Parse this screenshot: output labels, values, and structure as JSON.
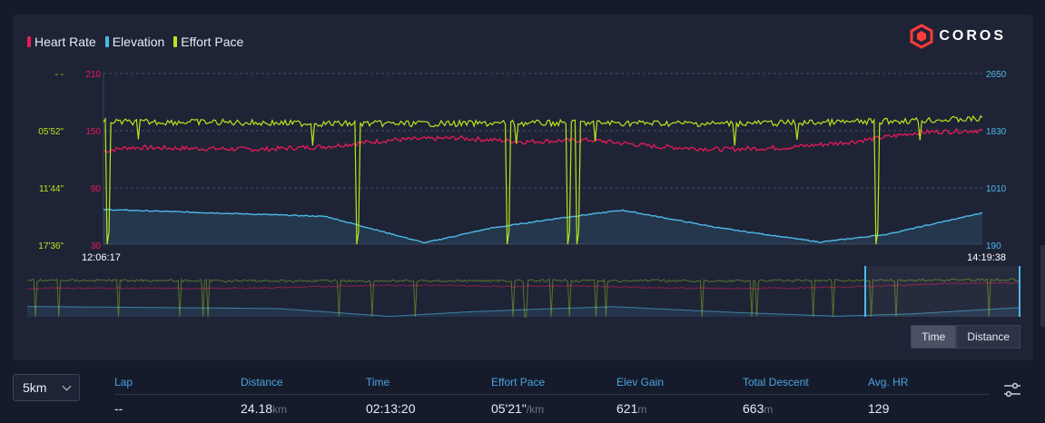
{
  "legend": [
    {
      "label": "Heart Rate",
      "color": "#e8195a"
    },
    {
      "label": "Elevation",
      "color": "#4fb8e8"
    },
    {
      "label": "Effort Pace",
      "color": "#b6e61e"
    }
  ],
  "brand": {
    "name": "COROS",
    "color": "#ff3b3b"
  },
  "axes": {
    "pace_ticks": [
      "- -",
      "05'52\"",
      "11'44\"",
      "17'36\""
    ],
    "hr_ticks": [
      "210",
      "150",
      "90",
      "30"
    ],
    "elev_ticks": [
      "2650",
      "1830",
      "1010",
      "190"
    ],
    "time_start": "12:06:17",
    "time_end": "14:19:38"
  },
  "toggle": {
    "time_label": "Time",
    "distance_label": "Distance",
    "selected": "Time"
  },
  "lap_select": {
    "value": "5km"
  },
  "table": {
    "headers": [
      "Lap",
      "Distance",
      "Time",
      "Effort Pace",
      "Elev Gain",
      "Total Descent",
      "Avg. HR"
    ],
    "row": {
      "lap": "--",
      "distance": "24.18",
      "distance_unit": "km",
      "time": "02:13:20",
      "pace": "05'21\"",
      "pace_unit": "/km",
      "elev_gain": "621",
      "elev_gain_unit": "m",
      "descent": "663",
      "descent_unit": "m",
      "avg_hr": "129"
    }
  },
  "chart_data": {
    "type": "line",
    "x_range": [
      "12:06:17",
      "14:19:38"
    ],
    "series": [
      {
        "name": "Heart Rate",
        "color": "#e8195a",
        "ylim": [
          30,
          210
        ],
        "x": [
          "12:06:17",
          "12:10",
          "12:20",
          "12:30",
          "12:40",
          "12:50",
          "13:00",
          "13:10",
          "13:20",
          "13:30",
          "13:40",
          "13:50",
          "14:00",
          "14:10",
          "14:19:38"
        ],
        "values": [
          128,
          132,
          131,
          130,
          133,
          140,
          142,
          138,
          140,
          133,
          130,
          132,
          138,
          148,
          150
        ]
      },
      {
        "name": "Elevation",
        "color": "#4fb8e8",
        "ylim": [
          190,
          2650
        ],
        "x": [
          "12:06:17",
          "12:20",
          "12:40",
          "12:55",
          "13:05",
          "13:15",
          "13:25",
          "13:40",
          "13:55",
          "14:05",
          "14:19:38"
        ],
        "values": [
          690,
          650,
          590,
          210,
          420,
          560,
          680,
          420,
          220,
          330,
          640
        ]
      },
      {
        "name": "Effort Pace",
        "color": "#b6e61e",
        "x": [
          "12:06:17",
          "12:20",
          "12:40",
          "13:00",
          "13:20",
          "13:40",
          "14:00",
          "14:19:38"
        ],
        "values_sec_per_km": [
          300,
          300,
          310,
          310,
          305,
          310,
          300,
          280
        ]
      }
    ]
  }
}
